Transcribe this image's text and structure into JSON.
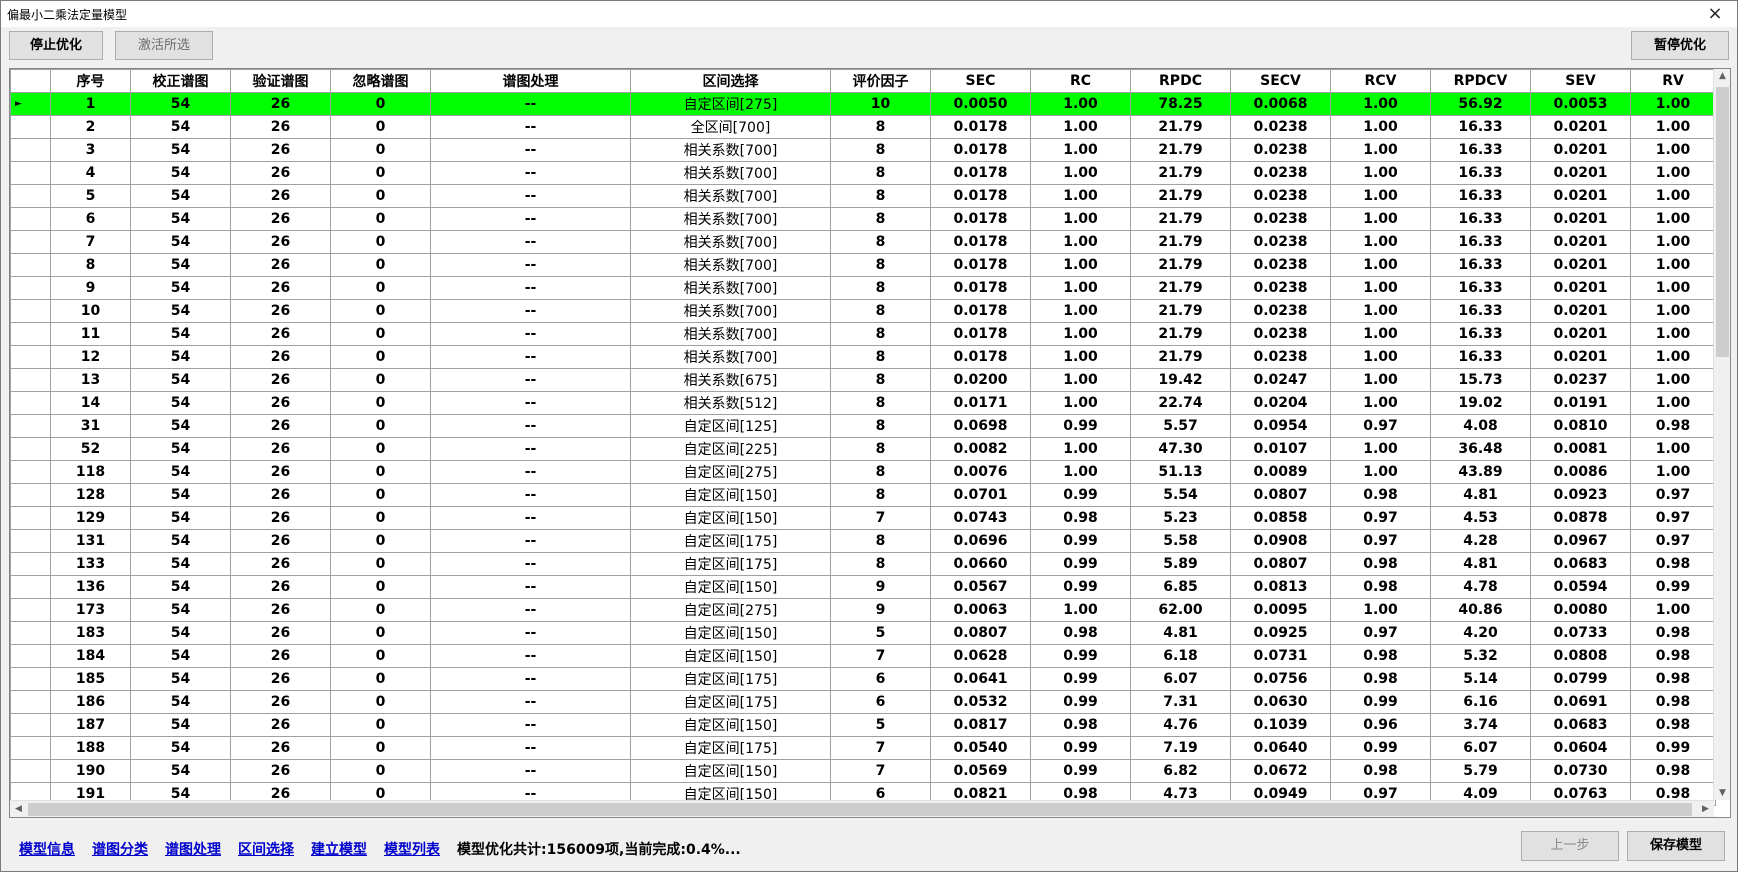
{
  "window": {
    "title": "偏最小二乘法定量模型",
    "close_icon": "×"
  },
  "toolbar": {
    "stop_label": "停止优化",
    "activate_label": "激活所选",
    "pause_label": "暂停优化"
  },
  "grid": {
    "columns": [
      "序号",
      "校正谱图",
      "验证谱图",
      "忽略谱图",
      "谱图处理",
      "区间选择",
      "评价因子",
      "SEC",
      "RC",
      "RPDC",
      "SECV",
      "RCV",
      "RPDCV",
      "SEV",
      "RV"
    ],
    "selected_color": "#00ff00",
    "rows": [
      [
        "1",
        "54",
        "26",
        "0",
        "--",
        "自定区间[275]",
        "10",
        "0.0050",
        "1.00",
        "78.25",
        "0.0068",
        "1.00",
        "56.92",
        "0.0053",
        "1.00"
      ],
      [
        "2",
        "54",
        "26",
        "0",
        "--",
        "全区间[700]",
        "8",
        "0.0178",
        "1.00",
        "21.79",
        "0.0238",
        "1.00",
        "16.33",
        "0.0201",
        "1.00"
      ],
      [
        "3",
        "54",
        "26",
        "0",
        "--",
        "相关系数[700]",
        "8",
        "0.0178",
        "1.00",
        "21.79",
        "0.0238",
        "1.00",
        "16.33",
        "0.0201",
        "1.00"
      ],
      [
        "4",
        "54",
        "26",
        "0",
        "--",
        "相关系数[700]",
        "8",
        "0.0178",
        "1.00",
        "21.79",
        "0.0238",
        "1.00",
        "16.33",
        "0.0201",
        "1.00"
      ],
      [
        "5",
        "54",
        "26",
        "0",
        "--",
        "相关系数[700]",
        "8",
        "0.0178",
        "1.00",
        "21.79",
        "0.0238",
        "1.00",
        "16.33",
        "0.0201",
        "1.00"
      ],
      [
        "6",
        "54",
        "26",
        "0",
        "--",
        "相关系数[700]",
        "8",
        "0.0178",
        "1.00",
        "21.79",
        "0.0238",
        "1.00",
        "16.33",
        "0.0201",
        "1.00"
      ],
      [
        "7",
        "54",
        "26",
        "0",
        "--",
        "相关系数[700]",
        "8",
        "0.0178",
        "1.00",
        "21.79",
        "0.0238",
        "1.00",
        "16.33",
        "0.0201",
        "1.00"
      ],
      [
        "8",
        "54",
        "26",
        "0",
        "--",
        "相关系数[700]",
        "8",
        "0.0178",
        "1.00",
        "21.79",
        "0.0238",
        "1.00",
        "16.33",
        "0.0201",
        "1.00"
      ],
      [
        "9",
        "54",
        "26",
        "0",
        "--",
        "相关系数[700]",
        "8",
        "0.0178",
        "1.00",
        "21.79",
        "0.0238",
        "1.00",
        "16.33",
        "0.0201",
        "1.00"
      ],
      [
        "10",
        "54",
        "26",
        "0",
        "--",
        "相关系数[700]",
        "8",
        "0.0178",
        "1.00",
        "21.79",
        "0.0238",
        "1.00",
        "16.33",
        "0.0201",
        "1.00"
      ],
      [
        "11",
        "54",
        "26",
        "0",
        "--",
        "相关系数[700]",
        "8",
        "0.0178",
        "1.00",
        "21.79",
        "0.0238",
        "1.00",
        "16.33",
        "0.0201",
        "1.00"
      ],
      [
        "12",
        "54",
        "26",
        "0",
        "--",
        "相关系数[700]",
        "8",
        "0.0178",
        "1.00",
        "21.79",
        "0.0238",
        "1.00",
        "16.33",
        "0.0201",
        "1.00"
      ],
      [
        "13",
        "54",
        "26",
        "0",
        "--",
        "相关系数[675]",
        "8",
        "0.0200",
        "1.00",
        "19.42",
        "0.0247",
        "1.00",
        "15.73",
        "0.0237",
        "1.00"
      ],
      [
        "14",
        "54",
        "26",
        "0",
        "--",
        "相关系数[512]",
        "8",
        "0.0171",
        "1.00",
        "22.74",
        "0.0204",
        "1.00",
        "19.02",
        "0.0191",
        "1.00"
      ],
      [
        "31",
        "54",
        "26",
        "0",
        "--",
        "自定区间[125]",
        "8",
        "0.0698",
        "0.99",
        "5.57",
        "0.0954",
        "0.97",
        "4.08",
        "0.0810",
        "0.98"
      ],
      [
        "52",
        "54",
        "26",
        "0",
        "--",
        "自定区间[225]",
        "8",
        "0.0082",
        "1.00",
        "47.30",
        "0.0107",
        "1.00",
        "36.48",
        "0.0081",
        "1.00"
      ],
      [
        "118",
        "54",
        "26",
        "0",
        "--",
        "自定区间[275]",
        "8",
        "0.0076",
        "1.00",
        "51.13",
        "0.0089",
        "1.00",
        "43.89",
        "0.0086",
        "1.00"
      ],
      [
        "128",
        "54",
        "26",
        "0",
        "--",
        "自定区间[150]",
        "8",
        "0.0701",
        "0.99",
        "5.54",
        "0.0807",
        "0.98",
        "4.81",
        "0.0923",
        "0.97"
      ],
      [
        "129",
        "54",
        "26",
        "0",
        "--",
        "自定区间[150]",
        "7",
        "0.0743",
        "0.98",
        "5.23",
        "0.0858",
        "0.97",
        "4.53",
        "0.0878",
        "0.97"
      ],
      [
        "131",
        "54",
        "26",
        "0",
        "--",
        "自定区间[175]",
        "8",
        "0.0696",
        "0.99",
        "5.58",
        "0.0908",
        "0.97",
        "4.28",
        "0.0967",
        "0.97"
      ],
      [
        "133",
        "54",
        "26",
        "0",
        "--",
        "自定区间[175]",
        "8",
        "0.0660",
        "0.99",
        "5.89",
        "0.0807",
        "0.98",
        "4.81",
        "0.0683",
        "0.98"
      ],
      [
        "136",
        "54",
        "26",
        "0",
        "--",
        "自定区间[150]",
        "9",
        "0.0567",
        "0.99",
        "6.85",
        "0.0813",
        "0.98",
        "4.78",
        "0.0594",
        "0.99"
      ],
      [
        "173",
        "54",
        "26",
        "0",
        "--",
        "自定区间[275]",
        "9",
        "0.0063",
        "1.00",
        "62.00",
        "0.0095",
        "1.00",
        "40.86",
        "0.0080",
        "1.00"
      ],
      [
        "183",
        "54",
        "26",
        "0",
        "--",
        "自定区间[150]",
        "5",
        "0.0807",
        "0.98",
        "4.81",
        "0.0925",
        "0.97",
        "4.20",
        "0.0733",
        "0.98"
      ],
      [
        "184",
        "54",
        "26",
        "0",
        "--",
        "自定区间[150]",
        "7",
        "0.0628",
        "0.99",
        "6.18",
        "0.0731",
        "0.98",
        "5.32",
        "0.0808",
        "0.98"
      ],
      [
        "185",
        "54",
        "26",
        "0",
        "--",
        "自定区间[175]",
        "6",
        "0.0641",
        "0.99",
        "6.07",
        "0.0756",
        "0.98",
        "5.14",
        "0.0799",
        "0.98"
      ],
      [
        "186",
        "54",
        "26",
        "0",
        "--",
        "自定区间[175]",
        "6",
        "0.0532",
        "0.99",
        "7.31",
        "0.0630",
        "0.99",
        "6.16",
        "0.0691",
        "0.98"
      ],
      [
        "187",
        "54",
        "26",
        "0",
        "--",
        "自定区间[150]",
        "5",
        "0.0817",
        "0.98",
        "4.76",
        "0.1039",
        "0.96",
        "3.74",
        "0.0683",
        "0.98"
      ],
      [
        "188",
        "54",
        "26",
        "0",
        "--",
        "自定区间[175]",
        "7",
        "0.0540",
        "0.99",
        "7.19",
        "0.0640",
        "0.99",
        "6.07",
        "0.0604",
        "0.99"
      ],
      [
        "190",
        "54",
        "26",
        "0",
        "--",
        "自定区间[150]",
        "7",
        "0.0569",
        "0.99",
        "6.82",
        "0.0672",
        "0.98",
        "5.79",
        "0.0730",
        "0.98"
      ],
      [
        "191",
        "54",
        "26",
        "0",
        "--",
        "自定区间[150]",
        "6",
        "0.0821",
        "0.98",
        "4.73",
        "0.0949",
        "0.97",
        "4.09",
        "0.0763",
        "0.98"
      ]
    ]
  },
  "footer": {
    "links": [
      "模型信息",
      "谱图分类",
      "谱图处理",
      "区间选择",
      "建立模型",
      "模型列表"
    ],
    "status": "模型优化共计:156009项,当前完成:0.4%...",
    "prev_label": "上一步",
    "save_label": "保存模型"
  }
}
